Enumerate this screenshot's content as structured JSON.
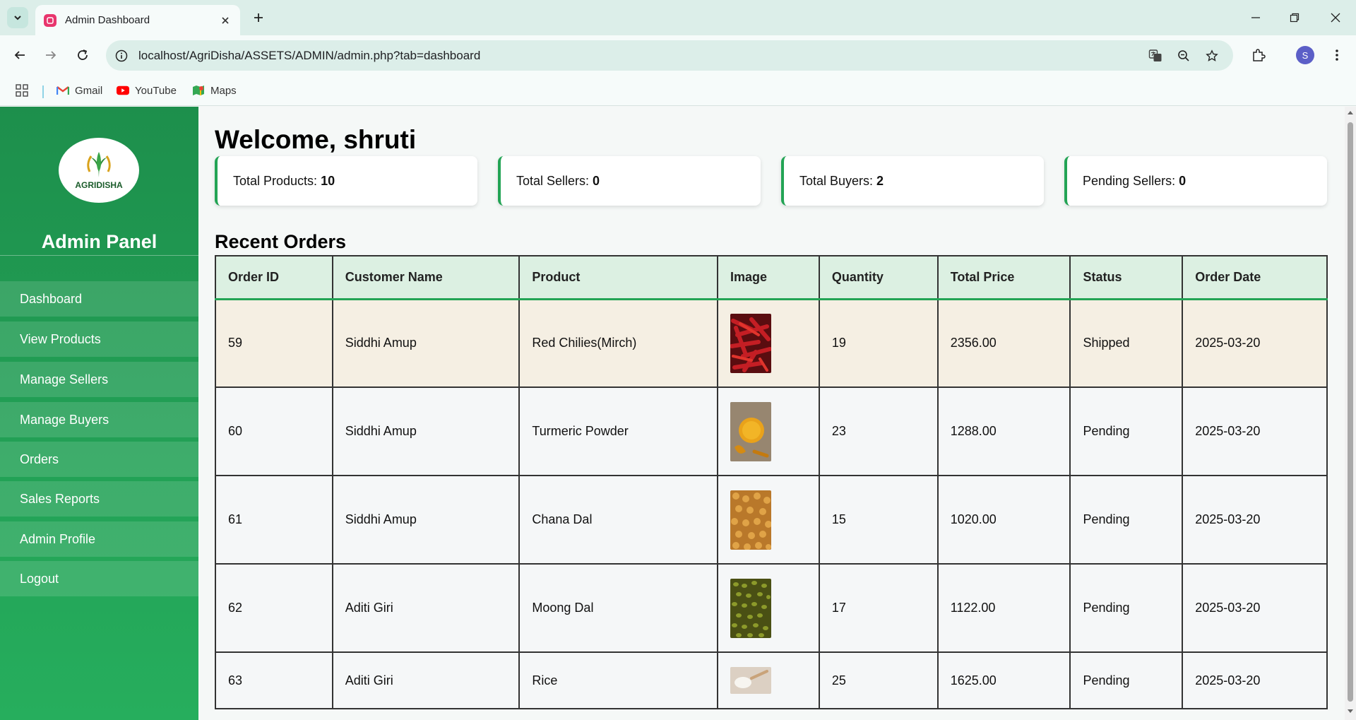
{
  "browser": {
    "tab_title": "Admin Dashboard",
    "url": "localhost/AgriDisha/ASSETS/ADMIN/admin.php?tab=dashboard",
    "profile_initial": "S",
    "bookmarks": [
      {
        "label": "Gmail",
        "icon": "gmail-icon"
      },
      {
        "label": "YouTube",
        "icon": "youtube-icon"
      },
      {
        "label": "Maps",
        "icon": "maps-icon"
      }
    ]
  },
  "sidebar": {
    "logo_text": "AGRIDISHA",
    "title": "Admin Panel",
    "items": [
      {
        "label": "Dashboard"
      },
      {
        "label": "View Products"
      },
      {
        "label": "Manage Sellers"
      },
      {
        "label": "Manage Buyers"
      },
      {
        "label": "Orders"
      },
      {
        "label": "Sales Reports"
      },
      {
        "label": "Admin Profile"
      },
      {
        "label": "Logout"
      }
    ]
  },
  "main": {
    "welcome": "Welcome, shruti",
    "stats": [
      {
        "label": "Total Products:",
        "value": "10"
      },
      {
        "label": "Total Sellers:",
        "value": "0"
      },
      {
        "label": "Total Buyers:",
        "value": "2"
      },
      {
        "label": "Pending Sellers:",
        "value": "0"
      }
    ],
    "recent_orders_title": "Recent Orders",
    "table": {
      "headers": [
        "Order ID",
        "Customer Name",
        "Product",
        "Image",
        "Quantity",
        "Total Price",
        "Status",
        "Order Date"
      ],
      "rows": [
        {
          "order_id": "59",
          "customer": "Siddhi Amup",
          "product": "Red Chilies(Mirch)",
          "image": "red-chilies-image",
          "quantity": "19",
          "total": "2356.00",
          "status": "Shipped",
          "date": "2025-03-20"
        },
        {
          "order_id": "60",
          "customer": "Siddhi Amup",
          "product": "Turmeric Powder",
          "image": "turmeric-image",
          "quantity": "23",
          "total": "1288.00",
          "status": "Pending",
          "date": "2025-03-20"
        },
        {
          "order_id": "61",
          "customer": "Siddhi Amup",
          "product": "Chana Dal",
          "image": "chana-dal-image",
          "quantity": "15",
          "total": "1020.00",
          "status": "Pending",
          "date": "2025-03-20"
        },
        {
          "order_id": "62",
          "customer": "Aditi Giri",
          "product": "Moong Dal",
          "image": "moong-dal-image",
          "quantity": "17",
          "total": "1122.00",
          "status": "Pending",
          "date": "2025-03-20"
        },
        {
          "order_id": "63",
          "customer": "Aditi Giri",
          "product": "Rice",
          "image": "rice-image",
          "quantity": "25",
          "total": "1625.00",
          "status": "Pending",
          "date": "2025-03-20"
        }
      ]
    }
  },
  "colors": {
    "sidebar_top": "#1d8f4c",
    "sidebar_bottom": "#26ae5d",
    "accent": "#23a455",
    "header_bg": "#dcf0e2",
    "highlight_row": "#f5efe3"
  }
}
